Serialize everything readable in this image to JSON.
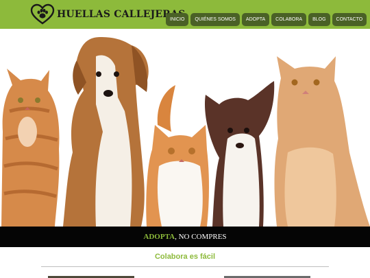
{
  "header": {
    "logo_text": "HUELLAS CALLEJERAS",
    "logo_icon": "heart-paw-icon"
  },
  "nav": {
    "items": [
      "INICIO",
      "QUIÉNES SOMOS",
      "ADOPTA",
      "COLABORA",
      "BLOG",
      "CONTACTO"
    ]
  },
  "hero": {
    "image": "cats-and-dogs-photo",
    "animals": [
      "orange-tabby-cat",
      "brown-white-dog",
      "orange-kitten",
      "chihuahua",
      "ginger-cat"
    ]
  },
  "slogan": {
    "accent": "ADOPTA",
    "rest": ", NO COMPRES"
  },
  "section": {
    "title": "Colabora es fácil"
  },
  "colors": {
    "brand_green": "#8dba3b",
    "nav_button": "#4a6126",
    "slogan_bg": "#050505"
  }
}
